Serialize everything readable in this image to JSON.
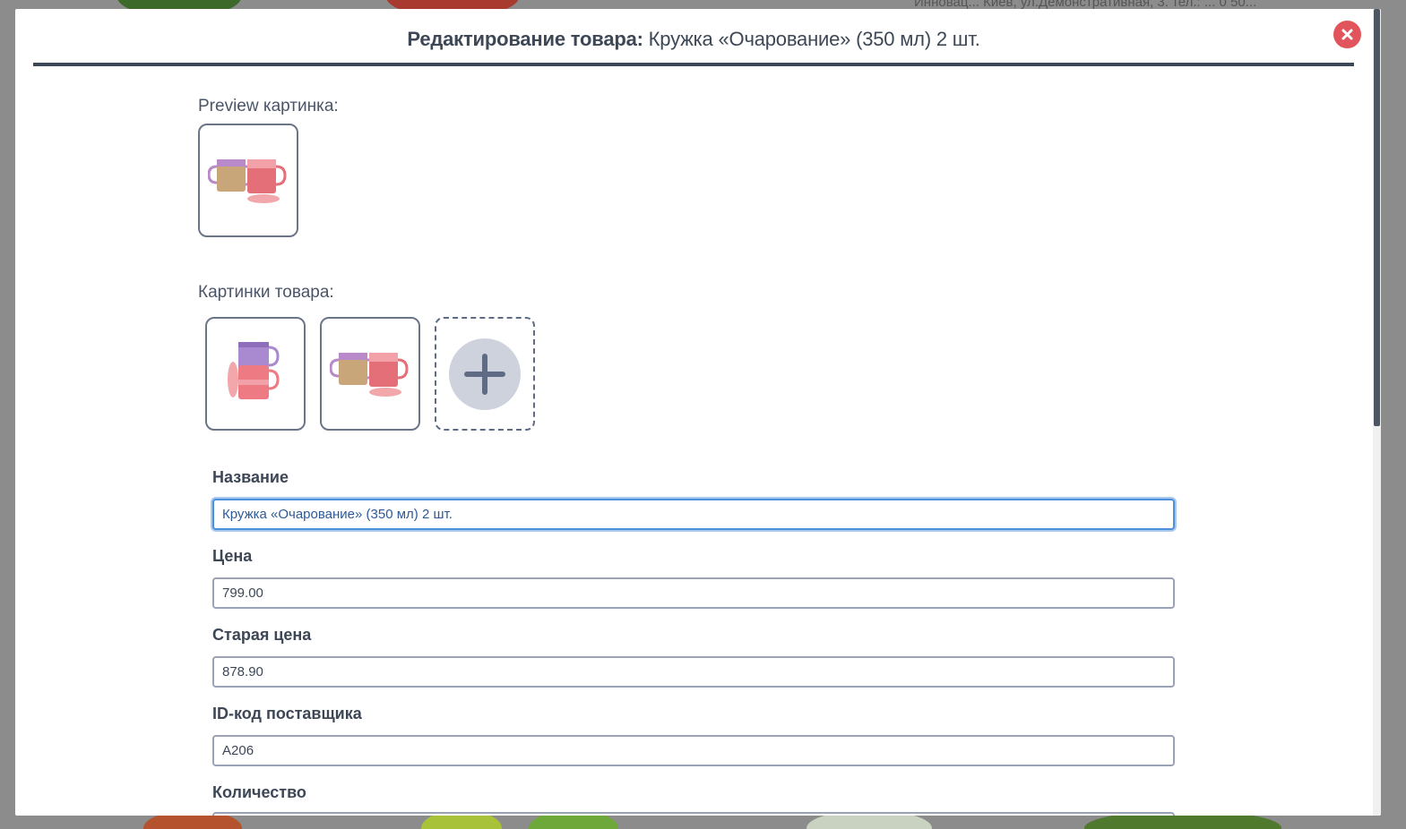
{
  "background": {
    "partial_text": "Инновац... Киев, ул.Демонстративная, 3. тел.: ... 0 50..."
  },
  "modal": {
    "title_prefix": "Редактирование товара:",
    "title_product": " Кружка «Очарование» (350 мл) 2 шт.",
    "close_icon": "close-icon"
  },
  "preview": {
    "label": "Preview картинка:",
    "image": "mugs-pair-image"
  },
  "gallery": {
    "label": "Картинки товара:",
    "images": [
      "mugs-stacked-image",
      "mugs-pair-image"
    ],
    "add_icon": "plus-icon"
  },
  "fields": {
    "name": {
      "label": "Название",
      "value": "Кружка «Очарование» (350 мл) 2 шт."
    },
    "price": {
      "label": "Цена",
      "value": "799.00"
    },
    "old_price": {
      "label": "Старая цена",
      "value": "878.90"
    },
    "supplier_id": {
      "label": "ID-код поставщика",
      "value": "A206"
    },
    "quantity": {
      "label": "Количество",
      "value": ""
    }
  },
  "colors": {
    "accent_focus": "#4d90d9",
    "close_button": "#e2545c",
    "header_rule": "#3d4756"
  }
}
